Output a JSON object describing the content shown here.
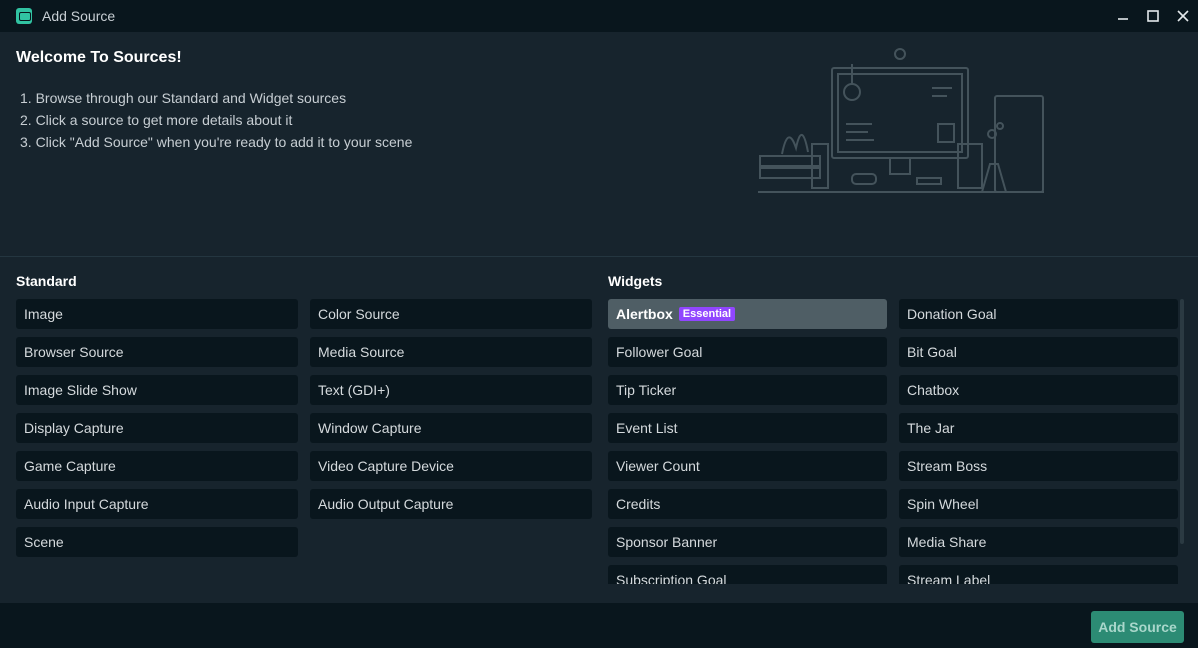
{
  "window": {
    "title": "Add Source"
  },
  "welcome": {
    "title": "Welcome To Sources!",
    "steps": [
      "1. Browse through our Standard and Widget sources",
      "2. Click a source to get more details about it",
      "3. Click \"Add Source\" when you're ready to add it to your scene"
    ]
  },
  "standard": {
    "title": "Standard",
    "left": [
      "Image",
      "Browser Source",
      "Image Slide Show",
      "Display Capture",
      "Game Capture",
      "Audio Input Capture",
      "Scene"
    ],
    "right": [
      "Color Source",
      "Media Source",
      "Text (GDI+)",
      "Window Capture",
      "Video Capture Device",
      "Audio Output Capture"
    ]
  },
  "widgets": {
    "title": "Widgets",
    "badge": "Essential",
    "left": [
      "Alertbox",
      "Follower Goal",
      "Tip Ticker",
      "Event List",
      "Viewer Count",
      "Credits",
      "Sponsor Banner",
      "Subscription Goal"
    ],
    "right": [
      "Donation Goal",
      "Bit Goal",
      "Chatbox",
      "The Jar",
      "Stream Boss",
      "Spin Wheel",
      "Media Share",
      "Stream Label"
    ]
  },
  "footer": {
    "add_label": "Add Source"
  },
  "colors": {
    "accent": "#31c3a2",
    "badge": "#9146ff",
    "button": "#2c8b74"
  },
  "icons": [
    "app-icon",
    "minimize-icon",
    "maximize-icon",
    "close-icon"
  ]
}
